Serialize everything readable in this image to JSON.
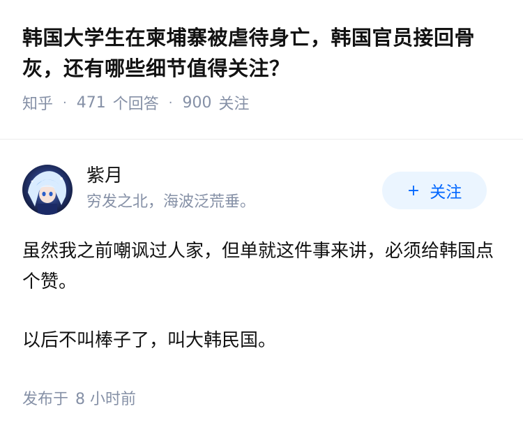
{
  "question": {
    "title": "韩国大学生在柬埔寨被虐待身亡，韩国官员接回骨灰，还有哪些细节值得关注？",
    "source": "知乎",
    "answer_count": "471",
    "answer_label": "个回答",
    "follower_count": "900",
    "follower_label": "关注"
  },
  "author": {
    "name": "紫月",
    "bio": "穷发之北，海波泛荒垂。",
    "avatar_icon": "anime-avatar-icon",
    "follow_label": "关注",
    "follow_icon": "plus-icon"
  },
  "answer": {
    "paragraphs": [
      "虽然我之前嘲讽过人家，但单就这件事来讲，必须给韩国点个赞。",
      "以后不叫棒子了，叫大韩民国。"
    ]
  },
  "meta": {
    "published_label": "发布于",
    "published_time": "8 小时前"
  },
  "colors": {
    "accent": "#0066ff",
    "follow_bg": "#ebf5ff",
    "muted_text": "#8590a6"
  }
}
